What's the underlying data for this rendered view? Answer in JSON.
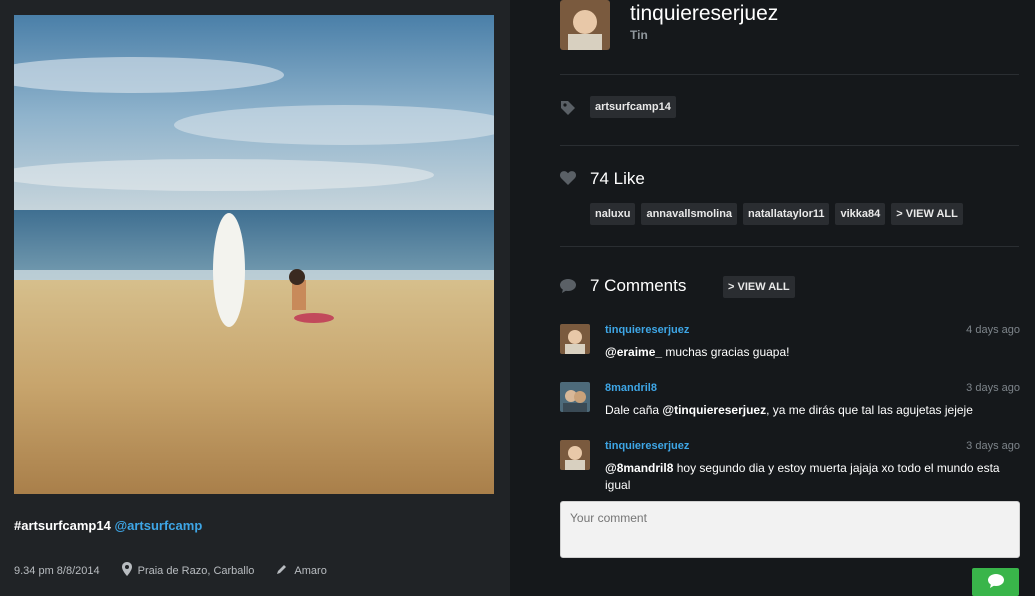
{
  "post": {
    "caption_tag": "#artsurfcamp14",
    "caption_mention": "@artsurfcamp",
    "datetime": "9.34 pm 8/8/2014",
    "location": "Praia de Razo, Carballo",
    "filter": "Amaro"
  },
  "user": {
    "username": "tinquiereserjuez",
    "fullname": "Tin"
  },
  "tags": [
    "artsurfcamp14"
  ],
  "likes": {
    "title": "74 Like",
    "users": [
      "naluxu",
      "annavallsmolina",
      "natallataylor11",
      "vikka84"
    ],
    "view_all": "> VIEW ALL"
  },
  "comments": {
    "title": "7 Comments",
    "view_all": "> VIEW ALL",
    "items": [
      {
        "user": "tinquiereserjuez",
        "time": "4 days ago",
        "mention": "@eraime_",
        "text_after": " muchas gracias guapa!"
      },
      {
        "user": "8mandril8",
        "time": "3 days ago",
        "text_before": "Dale caña ",
        "mention": "@tinquiereserjuez",
        "text_after": ", ya me dirás que tal las agujetas jejeje"
      },
      {
        "user": "tinquiereserjuez",
        "time": "3 days ago",
        "mention": "@8mandril8",
        "text_after": " hoy segundo dia y estoy muerta jajaja xo todo el mundo esta igual"
      }
    ]
  },
  "comment_input": {
    "placeholder": "Your comment"
  },
  "colors": {
    "link_blue": "#3ea6e6",
    "send_green": "#39b54a",
    "panel_dark": "#15181b",
    "panel_left": "#202326"
  }
}
